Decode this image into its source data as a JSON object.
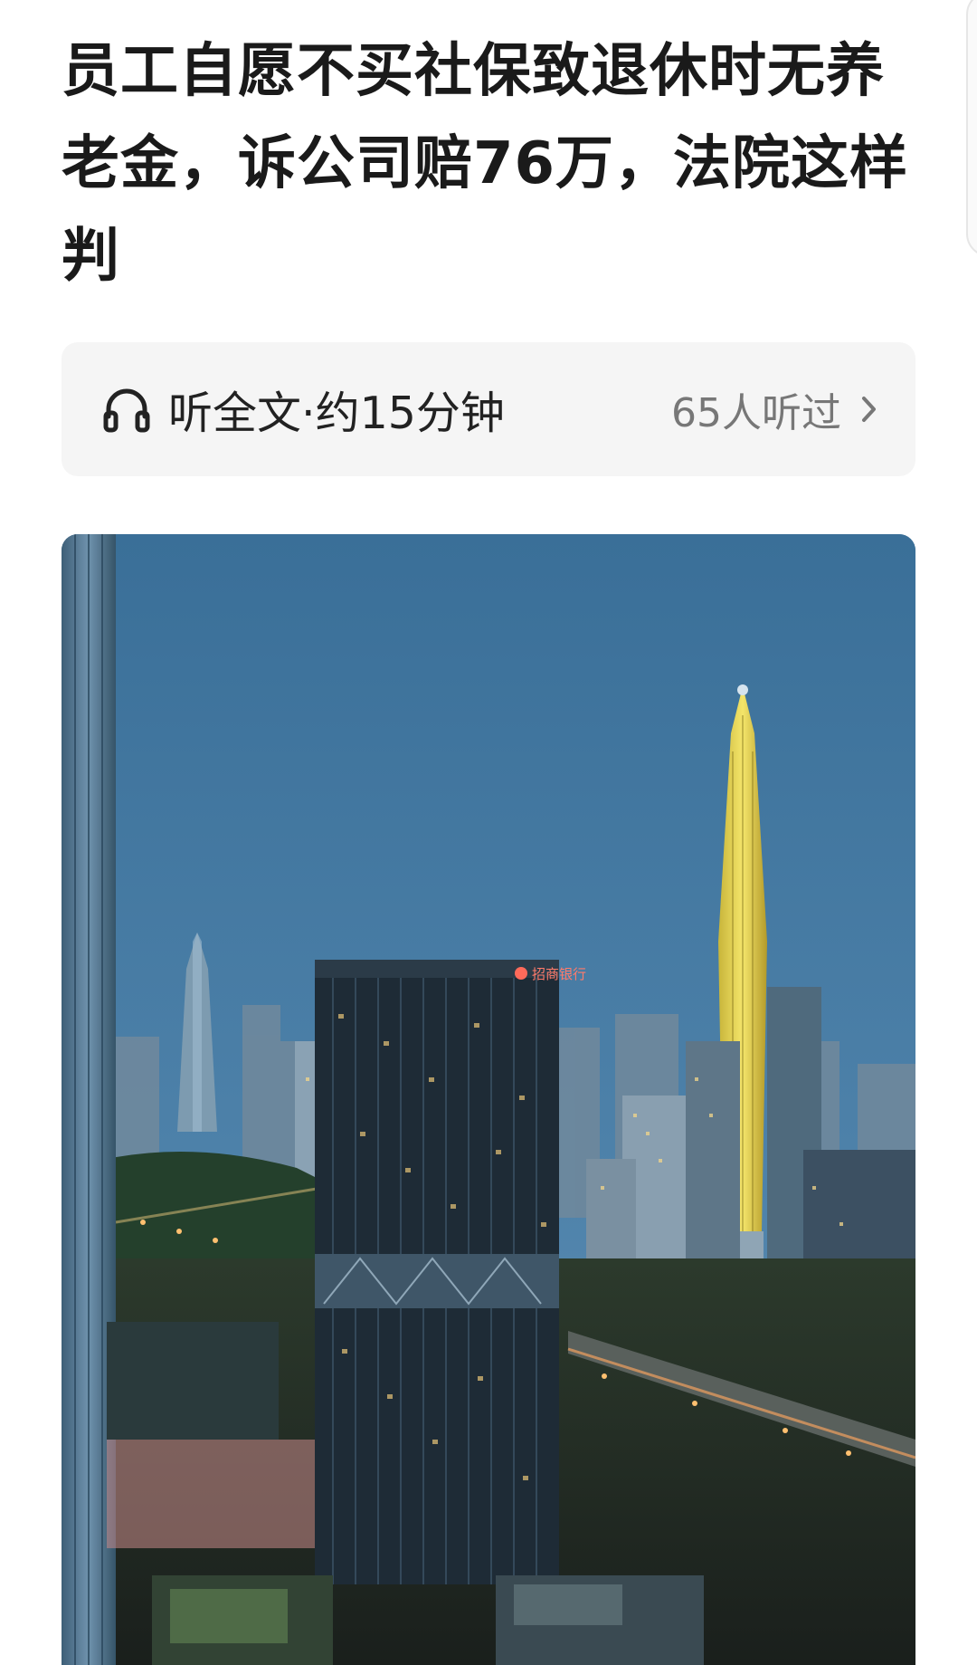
{
  "article": {
    "title": "员工自愿不买社保致退休时无养老金，诉公司赔76万，法院这样判"
  },
  "listen": {
    "label": "听全文·约15分钟",
    "count_text": "65人听过",
    "icon": "headphones-icon",
    "chevron_icon": "chevron-right-icon"
  },
  "hero_image": {
    "description_icon": "city-skyline-photo",
    "sign_text": "招商银行"
  },
  "colors": {
    "title": "#1a1a1a",
    "listen_bg": "#f5f5f5",
    "count": "#777777",
    "sky_top": "#3a6f98",
    "sky_bottom": "#5f8fb4"
  }
}
